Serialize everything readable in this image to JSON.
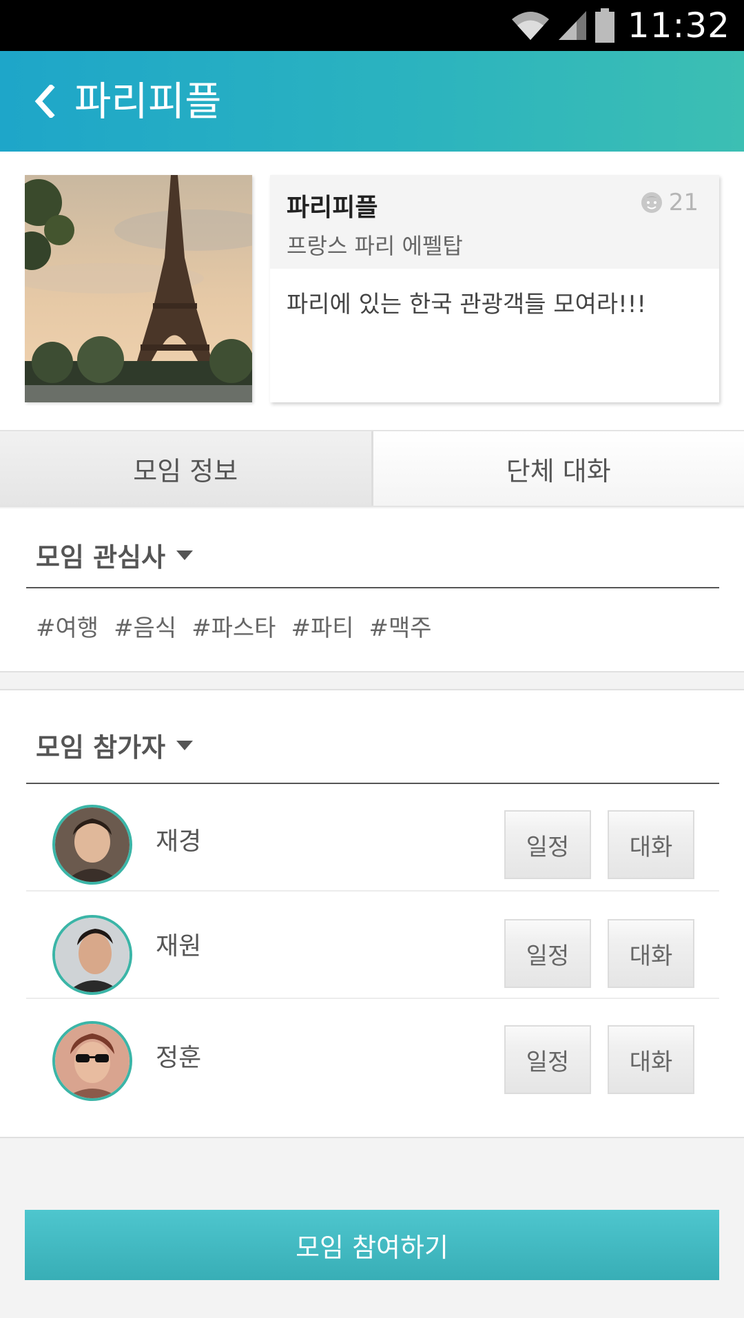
{
  "status_bar": {
    "time": "11:32",
    "icons": [
      "wifi-icon",
      "signal-icon",
      "battery-icon"
    ]
  },
  "app_bar": {
    "title": "파리피플",
    "back_icon": "chevron-left-icon"
  },
  "group": {
    "name": "파리피플",
    "location": "프랑스 파리 에펠탑",
    "member_count": "21",
    "description": "파리에 있는 한국 관광객들 모여라!!!"
  },
  "tabs": [
    {
      "label": "모임 정보",
      "active": true
    },
    {
      "label": "단체 대화",
      "active": false
    }
  ],
  "interests": {
    "heading": "모임 관심사",
    "tags": [
      "#여행",
      "#음식",
      "#파스타",
      "#파티",
      "#맥주"
    ]
  },
  "participants": {
    "heading": "모임 참가자",
    "schedule_label": "일정",
    "chat_label": "대화",
    "members": [
      {
        "name": "재경"
      },
      {
        "name": "재원"
      },
      {
        "name": "정훈"
      }
    ]
  },
  "join_button": {
    "label": "모임 참여하기"
  },
  "colors": {
    "header_start": "#1ea6c9",
    "header_end": "#3cbfb3",
    "accent": "#3bb5a7"
  }
}
